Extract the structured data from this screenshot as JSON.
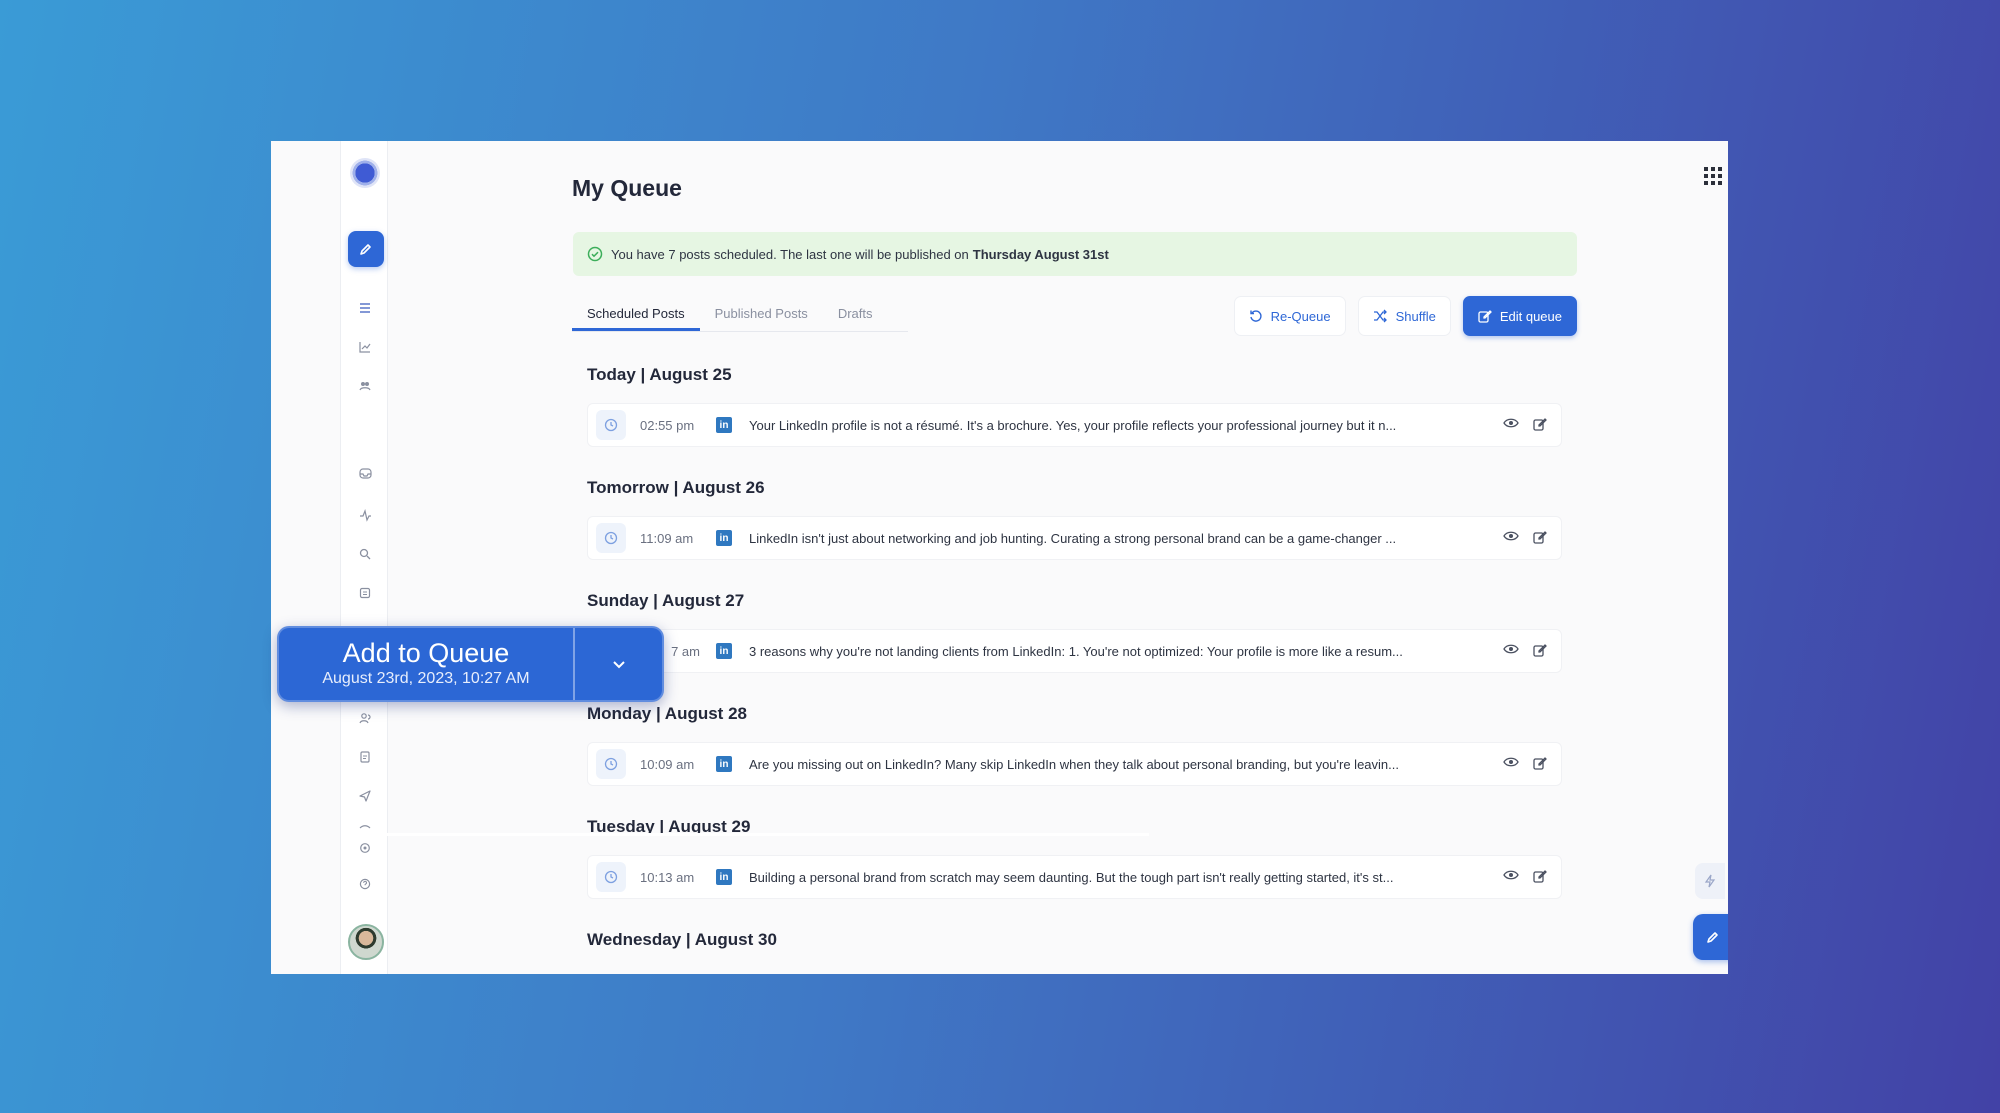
{
  "page": {
    "title": "My Queue"
  },
  "banner": {
    "text": "You have 7 posts scheduled. The last one will be published on",
    "bold": "Thursday August 31st"
  },
  "tabs": [
    {
      "label": "Scheduled Posts",
      "active": true
    },
    {
      "label": "Published Posts",
      "active": false
    },
    {
      "label": "Drafts",
      "active": false
    }
  ],
  "actions": {
    "requeue": "Re-Queue",
    "shuffle": "Shuffle",
    "edit_queue": "Edit queue"
  },
  "days": [
    {
      "heading": "Today | August 25",
      "time": "02:55 pm",
      "text": "Your LinkedIn profile is not a résumé. It's a brochure. Yes, your profile reflects your professional journey but it n..."
    },
    {
      "heading": "Tomorrow | August 26",
      "time": "11:09 am",
      "text": "LinkedIn isn't just about networking and job hunting. Curating a strong personal brand can be a game-changer ..."
    },
    {
      "heading": "Sunday | August 27",
      "time": "7 am",
      "text": "3 reasons why you're not landing clients from LinkedIn: 1. You're not optimized: Your profile is more like a resum..."
    },
    {
      "heading": "Monday | August 28",
      "time": "10:09 am",
      "text": "Are you missing out on LinkedIn? Many skip LinkedIn when they talk about personal branding, but you're leavin..."
    },
    {
      "heading": "Tuesday | August 29",
      "time": "10:13 am",
      "text": "Building a personal brand from scratch may seem daunting. But the tough part isn't really getting started, it's st..."
    },
    {
      "heading": "Wednesday | August 30"
    }
  ],
  "platform_icon": "linkedin-icon",
  "add_to_queue": {
    "title": "Add to Queue",
    "subtitle": "August 23rd, 2023, 10:27 AM"
  },
  "colors": {
    "accent": "#2e67d6",
    "banner_bg": "#e6f6e3",
    "banner_check": "#3cae5a",
    "linkedin": "#2f78c0"
  }
}
